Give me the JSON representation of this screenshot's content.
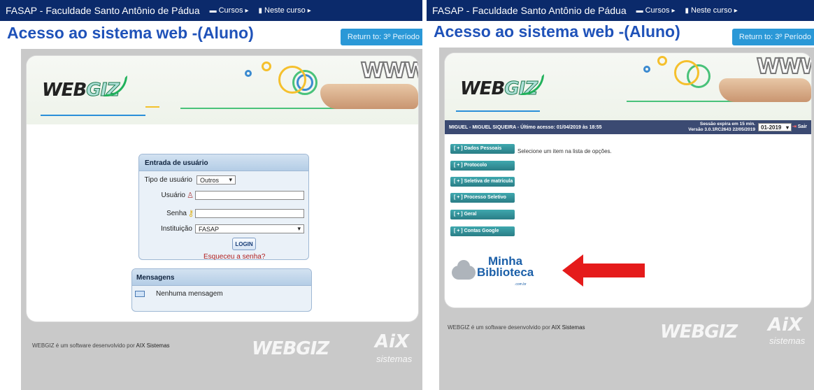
{
  "left": {
    "header": {
      "site": "FASAP - Faculdade Santo Antônio de Pádua",
      "nav_cursos": "Cursos",
      "nav_neste": "Neste curso"
    },
    "title": "Acesso ao sistema web -(Aluno)",
    "return_button": "Return to: 3º Período",
    "login": {
      "heading": "Entrada de usuário",
      "tipo_label": "Tipo de usuário",
      "tipo_value": "Outros",
      "usuario_label": "Usuário",
      "senha_label": "Senha",
      "instituicao_label": "Instituição",
      "instituicao_value": "FASAP",
      "button": "LOGIN",
      "forgot": "Esqueceu a senha?"
    },
    "messages": {
      "heading": "Mensagens",
      "empty": "Nenhuma mensagem"
    },
    "footer": {
      "text_prefix": "WEBGIZ é um software desenvolvido por ",
      "text_brand": "AIX Sistemas"
    },
    "logos": {
      "webgiz_a": "WEB",
      "webgiz_b": "GIZ",
      "www": "WWW",
      "footer_webgiz": "WEBGIZ",
      "aix": "AiX",
      "sistemas": "sistemas"
    }
  },
  "right": {
    "header": {
      "site": "FASAP - Faculdade Santo Antônio de Pádua",
      "nav_cursos": "Cursos",
      "nav_neste": "Neste curso"
    },
    "title": "Acesso ao sistema web -(Aluno)",
    "return_button": "Return to: 3º Período",
    "userbar": {
      "user": "MIGUEL - MIGUEL SIQUEIRA - Último acesso: 01/04/2019 às 18:55",
      "session_line1": "Sessão expira em 15 min.",
      "session_line2": "Versão 3.0.1RC2643 22/05/2019",
      "period": "01-2019",
      "exit": "Sair"
    },
    "menu": [
      "[ + ] Dados Pessoais",
      "[ + ] Protocolo",
      "[ + ] Seletiva de matrícula",
      "[ + ] Processo Seletivo",
      "[ + ] Geral",
      "[ + ] Contas Google"
    ],
    "select_message": "Selecione um item na lista de opções.",
    "minha_biblioteca": {
      "line1": "Minha",
      "line2": "Biblioteca",
      "sub": ".com.br"
    },
    "footer": {
      "text_prefix": "WEBGIZ é um software desenvolvido por ",
      "text_brand": "AIX Sistemas"
    },
    "logos": {
      "webgiz_a": "WEB",
      "webgiz_b": "GIZ",
      "www": "WWW",
      "footer_webgiz": "WEBGIZ",
      "aix": "AiX",
      "sistemas": "sistemas"
    }
  },
  "colors": {
    "topbar": "#0b2a6b",
    "title": "#1f52b9",
    "return_button": "#2a98d7",
    "menu_teal": "#2a7d86",
    "arrow_red": "#e51b1b"
  },
  "icons": [
    "cursos-icon",
    "book-icon",
    "caret-right-icon",
    "user-icon",
    "key-icon",
    "envelope-icon",
    "exit-icon",
    "dropdown-arrow-icon",
    "cloud-icon",
    "red-arrow-icon"
  ]
}
